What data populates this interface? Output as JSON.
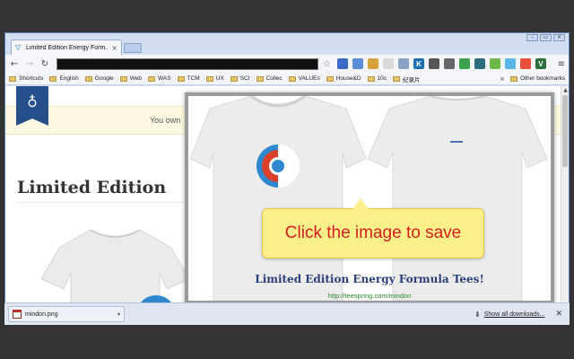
{
  "browser": {
    "tab_title": "Limited Edition Energy Form...",
    "tab_close": "×",
    "window_controls": [
      "–",
      "▭",
      "×"
    ]
  },
  "toolbar": {
    "back": "←",
    "forward": "→",
    "reload": "↻",
    "star": "☆",
    "menu": "≡",
    "extensions": [
      {
        "icon": "translate-icon",
        "label": "",
        "color": "#3b6bc7"
      },
      {
        "icon": "image-icon",
        "label": "",
        "color": "#5a8fd8"
      },
      {
        "icon": "photo-icon",
        "label": "",
        "color": "#d8a23a"
      },
      {
        "icon": "cube-icon",
        "label": "",
        "color": "#d9d9d9"
      },
      {
        "icon": "hand-icon",
        "label": "",
        "color": "#8aa2c4"
      },
      {
        "icon": "k-icon",
        "label": "K",
        "color": "#1f6fb5"
      },
      {
        "icon": "pocket-icon",
        "label": "",
        "color": "#555555"
      },
      {
        "icon": "mail-icon",
        "label": "",
        "color": "#666666"
      },
      {
        "icon": "refresh-ext-icon",
        "label": "",
        "color": "#3aa24a"
      },
      {
        "icon": "screen-icon",
        "label": "",
        "color": "#2d6e7e"
      },
      {
        "icon": "evernote-icon",
        "label": "",
        "color": "#6cb84a"
      },
      {
        "icon": "globe-icon",
        "label": "",
        "color": "#59b6e8"
      },
      {
        "icon": "palette-icon",
        "label": "",
        "color": "#e94e3c"
      },
      {
        "icon": "v-icon",
        "label": "V",
        "color": "#2d6e3a"
      }
    ]
  },
  "bookmarks": {
    "items": [
      "Shortcuts",
      "English",
      "Google",
      "Web",
      "WAS",
      "TCM",
      "UX",
      "SCI",
      "Collec",
      "VALUEs",
      "House&D",
      "10c",
      "纪录片"
    ],
    "more": "»",
    "other": "Other bookmarks"
  },
  "page": {
    "notice": "You own",
    "heading": "Limited Edition"
  },
  "popup": {
    "title": "Limited Edition Energy Formula Tees!",
    "url": "http://teespring.com/mindon"
  },
  "tooltip": {
    "text": "Click the image to save"
  },
  "downloads": {
    "file_name": "mindon.png",
    "caret": "▾",
    "show_all": "Show all downloads...",
    "arrow": "⬇",
    "close": "✕"
  },
  "colors": {
    "accent_blue": "#274f8c",
    "tooltip_bg": "#fdf08a",
    "tooltip_text": "#d21f1f",
    "logo_blue": "#2e88d0",
    "logo_red": "#d9412a"
  }
}
